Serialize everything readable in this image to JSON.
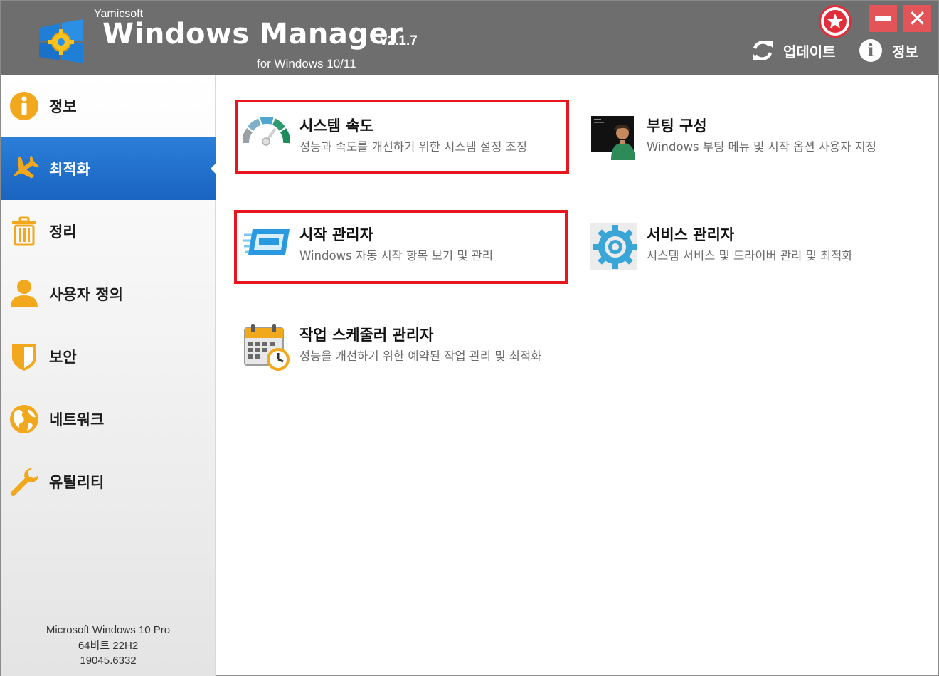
{
  "header": {
    "brand": "Yamicsoft",
    "app_name": "Windows Manager",
    "version": "v2.1.7",
    "subtitle": "for Windows 10/11",
    "buttons": {
      "update_label": "업데이트",
      "info_label": "정보",
      "close_glyph": "✕"
    }
  },
  "sidebar": {
    "items": [
      {
        "label": "정보",
        "icon": "info-icon"
      },
      {
        "label": "최적화",
        "icon": "airplane-icon",
        "active": true
      },
      {
        "label": "정리",
        "icon": "trash-icon"
      },
      {
        "label": "사용자 정의",
        "icon": "user-icon"
      },
      {
        "label": "보안",
        "icon": "shield-icon"
      },
      {
        "label": "네트워크",
        "icon": "globe-icon"
      },
      {
        "label": "유틸리티",
        "icon": "wrench-icon"
      }
    ],
    "system_info": {
      "os": "Microsoft Windows 10 Pro",
      "arch": "64비트 22H2",
      "build": "19045.6332"
    }
  },
  "main": {
    "cards": [
      {
        "title": "시스템 속도",
        "description": "성능과 속도를 개선하기 위한 시스템 설정 조정",
        "icon": "speedometer-icon",
        "highlighted": true
      },
      {
        "title": "부팅 구성",
        "description": "Windows 부팅 메뉴 및 시작 옵션 사용자 지정",
        "icon": "boot-console-icon",
        "highlighted": false
      },
      {
        "title": "시작 관리자",
        "description": "Windows 자동 시작 항목 보기 및 관리",
        "icon": "startup-window-icon",
        "highlighted": true
      },
      {
        "title": "서비스 관리자",
        "description": "시스템 서비스 및 드라이버 관리 및 최적화",
        "icon": "gear-icon",
        "highlighted": false
      },
      {
        "title": "작업 스케줄러 관리자",
        "description": "성능을 개선하기 위한 예약된 작업 관리 및 최적화",
        "icon": "calendar-clock-icon",
        "highlighted": false
      }
    ]
  },
  "colors": {
    "titlebar": "#6e6e6e",
    "accent": "#1f6fcc",
    "icon_orange": "#f2a81d",
    "highlight": "#e8141e",
    "window_button": "#e25458"
  }
}
